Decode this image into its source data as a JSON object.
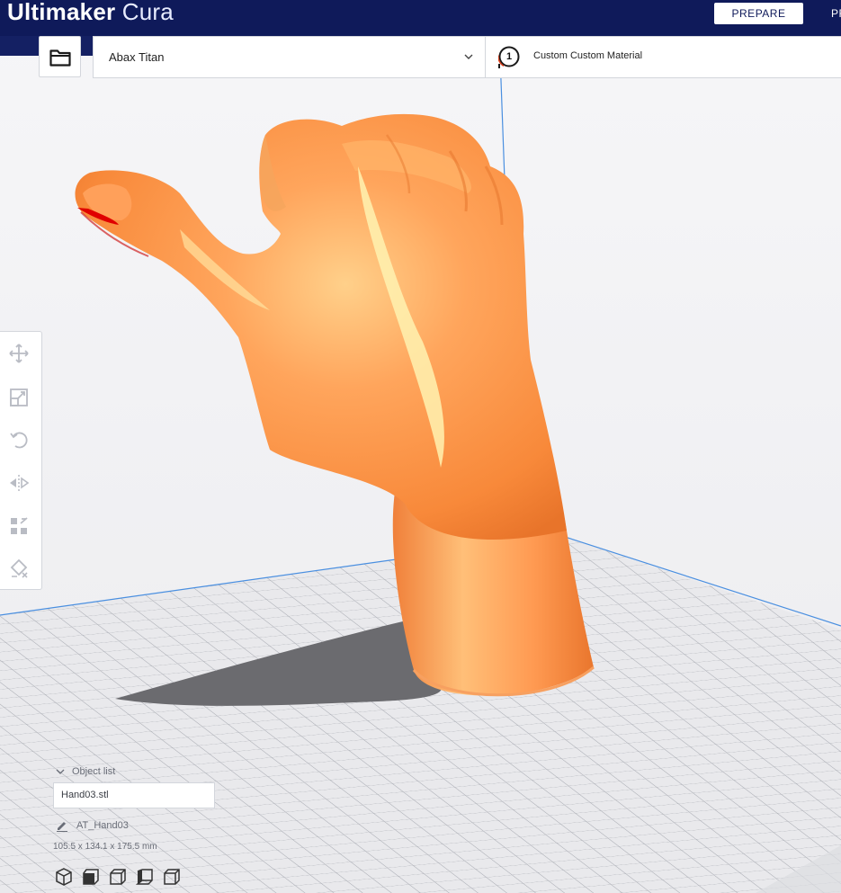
{
  "header": {
    "brand_bold": "Ultimaker",
    "brand_light": "Cura",
    "stage_active": "PREPARE",
    "stage_next": "PR",
    "header_color": "#0f1a5a"
  },
  "toolbar": {
    "open_icon": "folder-icon",
    "printer_name": "Abax Titan",
    "printer_chevron_icon": "chevron-down-icon",
    "extruder_number": "1",
    "material_name": "Custom Custom Material"
  },
  "viewport": {
    "model_color": "#ff8c40",
    "overhang_color": "#e00000",
    "build_plate_color": "#e8e8ea"
  },
  "tools": [
    {
      "name": "move-icon"
    },
    {
      "name": "scale-icon"
    },
    {
      "name": "rotate-icon"
    },
    {
      "name": "mirror-icon"
    },
    {
      "name": "per-model-settings-icon"
    },
    {
      "name": "support-blocker-icon"
    }
  ],
  "object_list": {
    "toggle_label": "Object list",
    "selected_file": "Hand03.stl",
    "job_name": "AT_Hand03",
    "dimensions": "105.5 x 134.1 x 175.5 mm"
  },
  "view_buttons": [
    {
      "name": "3d-view-icon"
    },
    {
      "name": "front-view-icon"
    },
    {
      "name": "top-view-icon"
    },
    {
      "name": "left-view-icon"
    },
    {
      "name": "right-view-icon"
    }
  ]
}
